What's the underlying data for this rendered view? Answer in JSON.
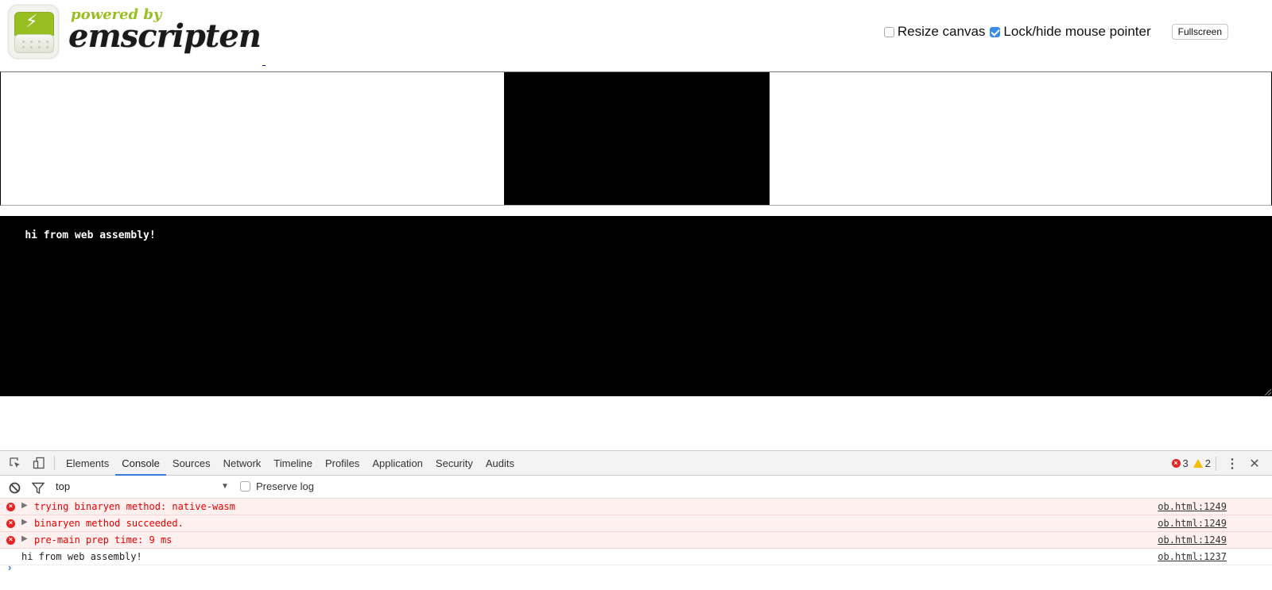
{
  "header": {
    "logo": {
      "powered_by": "powered by",
      "brand": "emscripten",
      "bolt_icon": "⚡"
    },
    "resize_canvas": {
      "label": "Resize canvas",
      "checked": false
    },
    "lock_pointer": {
      "label": "Lock/hide mouse pointer",
      "checked": true
    },
    "fullscreen_label": "Fullscreen"
  },
  "output": {
    "text": "hi from web assembly!"
  },
  "devtools": {
    "tabs": [
      {
        "label": "Elements",
        "active": false
      },
      {
        "label": "Console",
        "active": true
      },
      {
        "label": "Sources",
        "active": false
      },
      {
        "label": "Network",
        "active": false
      },
      {
        "label": "Timeline",
        "active": false
      },
      {
        "label": "Profiles",
        "active": false
      },
      {
        "label": "Application",
        "active": false
      },
      {
        "label": "Security",
        "active": false
      },
      {
        "label": "Audits",
        "active": false
      }
    ],
    "error_count": "3",
    "warning_count": "2",
    "context": "top",
    "preserve_log": {
      "label": "Preserve log",
      "checked": false
    },
    "messages": [
      {
        "level": "error",
        "text": "trying binaryen method: native-wasm",
        "source": "ob.html:1249"
      },
      {
        "level": "error",
        "text": "binaryen method succeeded.",
        "source": "ob.html:1249"
      },
      {
        "level": "error",
        "text": "pre-main prep time: 9 ms",
        "source": "ob.html:1249"
      },
      {
        "level": "log",
        "text": "hi from web assembly!",
        "source": "ob.html:1237"
      }
    ],
    "prompt_symbol": "›"
  },
  "colors": {
    "brand_green": "#98bf21",
    "error_red": "#e60000",
    "error_bg": "#fff0f0",
    "active_tab": "#3879d9"
  }
}
